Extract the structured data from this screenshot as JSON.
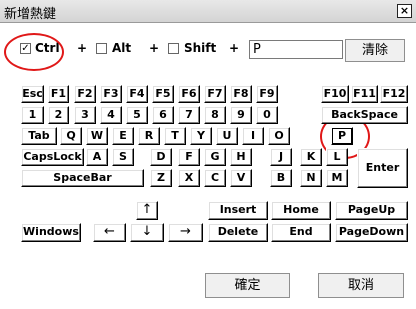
{
  "window": {
    "title": "新增熱鍵",
    "close_glyph": "×"
  },
  "modifiers": {
    "ctrl": {
      "label": "Ctrl",
      "checked": true
    },
    "alt": {
      "label": "Alt",
      "checked": false
    },
    "shift": {
      "label": "Shift",
      "checked": false
    },
    "plus": "+"
  },
  "hotkey_field": {
    "value": "P"
  },
  "clear_button": "清除",
  "keyboard": {
    "row1": [
      "Esc",
      "F1",
      "F2",
      "F3",
      "F4",
      "F5",
      "F6",
      "F7",
      "F8",
      "F9",
      "F10",
      "F11",
      "F12"
    ],
    "row2": [
      "1",
      "2",
      "3",
      "4",
      "5",
      "6",
      "7",
      "8",
      "9",
      "0",
      "BackSpace"
    ],
    "row3": [
      "Tab",
      "Q",
      "W",
      "E",
      "R",
      "T",
      "Y",
      "U",
      "I",
      "O",
      "P"
    ],
    "row4": [
      "CapsLock",
      "A",
      "S",
      "D",
      "F",
      "G",
      "H",
      "J",
      "K",
      "L"
    ],
    "row5": [
      "SpaceBar",
      "Z",
      "X",
      "C",
      "V",
      "B",
      "N",
      "M"
    ],
    "enter": "Enter",
    "arrows": {
      "up": "↑",
      "left": "←",
      "down": "↓",
      "right": "→"
    },
    "nav": [
      "Insert",
      "Home",
      "PageUp",
      "Delete",
      "End",
      "PageDown"
    ],
    "windows": "Windows"
  },
  "ok_button": "確定",
  "cancel_button": "取消",
  "annotation_color": "#e01818"
}
